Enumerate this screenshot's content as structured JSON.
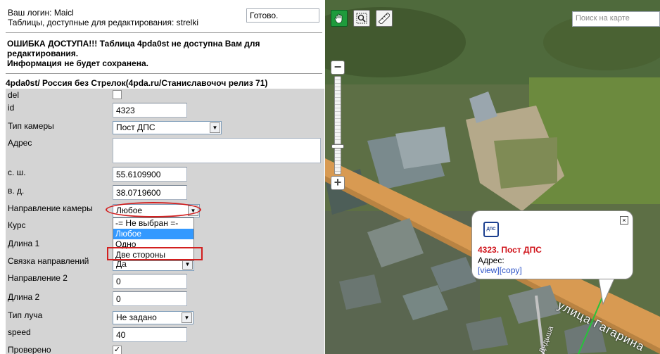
{
  "session": {
    "login_line": "Ваш логин: Maicl",
    "tables_line": "Таблицы, доступные для редактирования: strelki",
    "status_value": "Готово."
  },
  "error": {
    "line1": "ОШИБКА ДОСТУПА!!! Таблица 4pda0st не доступна Вам для",
    "line2": "редактирования.",
    "line3": "Информация не будет сохранена."
  },
  "table_title": "4pda0st/ Россия без Стрелок(4pda.ru/Станиславочоч релиз 71)",
  "form": {
    "del_label": "del",
    "del_checked": false,
    "id_label": "id",
    "id_value": "4323",
    "camera_type_label": "Тип камеры",
    "camera_type_value": "Пост ДПС",
    "address_label": "Адрес",
    "address_value": "",
    "lat_label": "с. ш.",
    "lat_value": "55.6109900",
    "lon_label": "в. д.",
    "lon_value": "38.0719600",
    "direction_label": "Направление камеры",
    "direction_value": "Любое",
    "direction_options": [
      "-= Не выбран =-",
      "Любое",
      "Одно",
      "Две стороны"
    ],
    "direction_highlighted": "Любое",
    "course_label": "Курс",
    "length1_label": "Длина 1",
    "link_label": "Связка направлений",
    "link_value": "Да",
    "direction2_label": "Направление 2",
    "direction2_value": "0",
    "length2_label": "Длина 2",
    "length2_value": "0",
    "beam_label": "Тип луча",
    "beam_value": "Не задано",
    "speed_label": "speed",
    "speed_value": "40",
    "checked_label": "Проверено",
    "checked_checked": true
  },
  "map": {
    "search_placeholder": "Поиск на карте",
    "zoom_in": "+",
    "zoom_out": "−",
    "popup": {
      "icon_text": "ДПС",
      "title": "4323. Пост ДПС",
      "address_label": "Адрес:",
      "link_view": "[view]",
      "link_copy": "[copy]",
      "close": "×"
    },
    "street_label": "улица Гагарина",
    "street_label2": "Дядьша"
  },
  "colors": {
    "error_red": "#d0141b",
    "highlight_blue": "#3399ff",
    "form_gray": "#d4d4d4",
    "road_orange": "#d89a52",
    "active_tool_green": "#1f9b3c"
  },
  "icons": [
    "hand-pan-icon",
    "zoom-box-icon",
    "ruler-icon",
    "close-icon",
    "dps-sign-icon",
    "dropdown-arrow-icon"
  ]
}
